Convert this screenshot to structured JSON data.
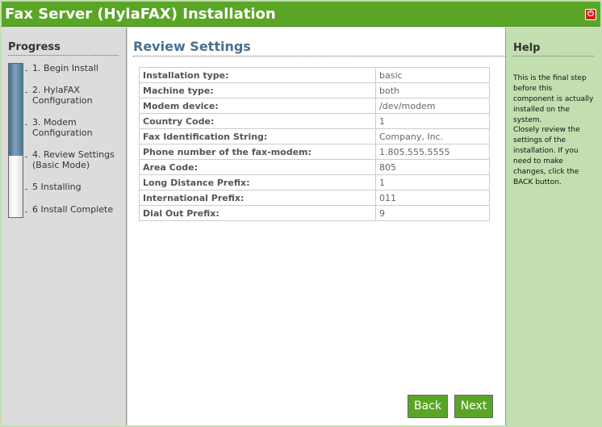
{
  "header": {
    "title": "Fax Server (HylaFAX) Installation",
    "power_icon": "power-icon"
  },
  "sidebar": {
    "title": "Progress",
    "progress_fraction": 0.6,
    "steps": [
      "1. Begin Install",
      [
        "2. HylaFAX",
        "Configuration"
      ],
      [
        "3. Modem",
        "Configuration"
      ],
      [
        "4. Review Settings",
        "(Basic Mode)"
      ],
      "5 Installing",
      "6 Install Complete"
    ]
  },
  "main": {
    "title": "Review Settings",
    "rows": [
      {
        "label": "Installation type:",
        "value": "basic"
      },
      {
        "label": "Machine type:",
        "value": "both"
      },
      {
        "label": "Modem device:",
        "value": "/dev/modem"
      },
      {
        "label": "Country Code:",
        "value": "1"
      },
      {
        "label": "Fax Identification String:",
        "value": "Company, Inc."
      },
      {
        "label": "Phone number of the fax-modem:",
        "value": "1.805.555.5555"
      },
      {
        "label": "Area Code:",
        "value": "805"
      },
      {
        "label": "Long Distance Prefix:",
        "value": "1"
      },
      {
        "label": "International Prefix:",
        "value": "011"
      },
      {
        "label": "Dial Out Prefix:",
        "value": "9"
      }
    ],
    "back_label": "Back",
    "next_label": "Next"
  },
  "help": {
    "title": "Help",
    "paragraphs": [
      "This is the final step before this component is actually installed on the system.",
      "Closely review the settings of the installation. If you need to make changes, click the BACK button."
    ]
  }
}
